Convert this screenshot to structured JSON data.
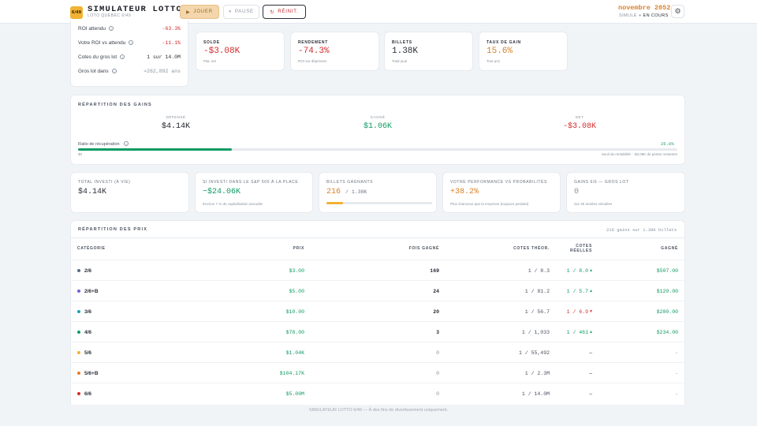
{
  "header": {
    "logo_text": "6/49",
    "title": "SIMULATEUR LOTTO",
    "subtitle": "LOTO QUÉBEC 6/49",
    "play_label": "JOUER",
    "pause_label": "PAUSE",
    "reset_label": "RÉINIT.",
    "date": "novembre 2052",
    "status_label": "SIMULÉ",
    "status_value": "EN COURS"
  },
  "odds": [
    {
      "label": "ROI attendu",
      "value": "-63.3%",
      "tone": "red"
    },
    {
      "label": "Votre ROI vs attendu",
      "value": "-11.1%",
      "tone": "red"
    },
    {
      "label": "Cotes du gros lot",
      "value": "1 sur 14.0M",
      "tone": "dark"
    },
    {
      "label": "Gros lot dans",
      "value": "≈262,892 ans",
      "tone": "muted"
    }
  ],
  "stats": [
    {
      "label": "SOLDE",
      "value": "-$3.08K",
      "sub": "P&L net",
      "tone": "red"
    },
    {
      "label": "RENDEMENT",
      "value": "-74.3%",
      "sub": "ROI sur dépenses",
      "tone": "red"
    },
    {
      "label": "BILLETS",
      "value": "1.38K",
      "sub": "Total joué",
      "tone": "dark"
    },
    {
      "label": "TAUX DE GAIN",
      "value": "15.6%",
      "sub": "Tout prix",
      "tone": "orange"
    }
  ],
  "gains": {
    "title": "RÉPARTITION DES GAINS",
    "spent_label": "DÉPENSÉ",
    "spent_value": "$4.14K",
    "won_label": "GAGNÉ",
    "won_value": "$1.06K",
    "net_label": "NET",
    "net_value": "-$3.08K",
    "recovery_label": "Ratio de récupération",
    "recovery_pct": "25.6%",
    "recovery_fraction": 0.256,
    "zero_label": "$0",
    "breakeven_note": "Seuil de rentabilité : -$3.08K de pertes restantes"
  },
  "mini": [
    {
      "label": "TOTAL INVESTI (À VIE)",
      "value": "$4.14K",
      "sub": "",
      "tone": "dark"
    },
    {
      "label": "SI INVESTI DANS LE S&P 500 À LA PLACE",
      "value": "~$24.06K",
      "sub": "Environ 7 % de capitalisation annuelle",
      "tone": "green"
    },
    {
      "label": "BILLETS GAGNANTS",
      "value": "216",
      "value_extra": "/ 1.38K",
      "sub": "",
      "tone": "orange",
      "fill": 0.156
    },
    {
      "label": "VOTRE PERFORMANCE VS PROBABILITÉS",
      "value": "+38.2%",
      "sub": "Plus chanceux que la moyenne (toujours perdant)",
      "tone": "orange"
    },
    {
      "label": "GAINS 6/6 — GROS LOT",
      "value": "0",
      "sub": "Sur 36 années simulées",
      "tone": "muted"
    }
  ],
  "prizes": {
    "title": "RÉPARTITION DES PRIX",
    "summary": "216 gains sur 1.38K billets",
    "headers": {
      "category": "CATÉGORIE",
      "prize": "PRIX",
      "times": "FOIS GAGNÉ",
      "theo": "COTES THÉOR.",
      "real": "COTES RÉELLES",
      "won": "GAGNÉ"
    },
    "rows": [
      {
        "cat": "2/6",
        "dot": "#5b6a85",
        "prize": "$3.00",
        "times": "169",
        "times_tone": "dark",
        "theo": "1 / 8.3",
        "real": "1 / 8.0",
        "arrow": "▲",
        "arrow_tone": "green",
        "won": "$507.00",
        "won_tone": "green"
      },
      {
        "cat": "2/6+B",
        "dot": "#7a5cd6",
        "prize": "$5.00",
        "times": "24",
        "times_tone": "dark",
        "theo": "1 / 81.2",
        "real": "1 / 5.7",
        "arrow": "▲",
        "arrow_tone": "green",
        "won": "$120.00",
        "won_tone": "green"
      },
      {
        "cat": "3/6",
        "dot": "#1aa3b8",
        "prize": "$10.00",
        "times": "20",
        "times_tone": "dark",
        "theo": "1 / 56.7",
        "real": "1 / 6.9",
        "arrow": "▼",
        "arrow_tone": "red",
        "won": "$200.00",
        "won_tone": "green"
      },
      {
        "cat": "4/6",
        "dot": "#0f9a63",
        "prize": "$78.00",
        "times": "3",
        "times_tone": "dark",
        "theo": "1 / 1,033",
        "real": "1 / 461",
        "arrow": "▲",
        "arrow_tone": "green",
        "won": "$234.00",
        "won_tone": "green"
      },
      {
        "cat": "5/6",
        "dot": "#f2b233",
        "prize": "$1.04K",
        "times": "0",
        "times_tone": "muted",
        "theo": "1 / 55,492",
        "real": "—",
        "arrow": "",
        "arrow_tone": "green",
        "won": "-",
        "won_tone": "muted"
      },
      {
        "cat": "5/6+B",
        "dot": "#e67a22",
        "prize": "$104.17K",
        "times": "0",
        "times_tone": "muted",
        "theo": "1 / 2.3M",
        "real": "—",
        "arrow": "",
        "arrow_tone": "green",
        "won": "-",
        "won_tone": "muted"
      },
      {
        "cat": "6/6",
        "dot": "#d42b2b",
        "prize": "$5.00M",
        "times": "0",
        "times_tone": "muted",
        "theo": "1 / 14.0M",
        "real": "—",
        "arrow": "",
        "arrow_tone": "green",
        "won": "-",
        "won_tone": "muted"
      }
    ]
  },
  "footer": "SIMULATEUR LOTTO 6/49 — À des fins de divertissement uniquement."
}
